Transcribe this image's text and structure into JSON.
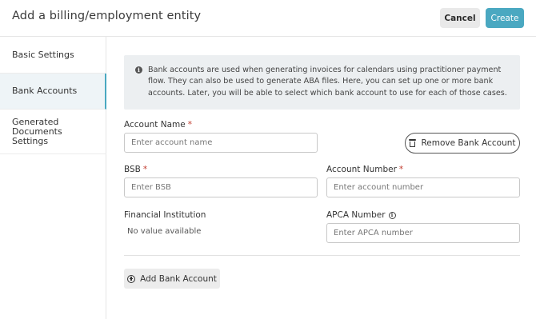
{
  "header": {
    "title": "Add a billing/employment entity",
    "cancel_label": "Cancel",
    "create_label": "Create"
  },
  "sidebar": {
    "items": [
      {
        "label": "Basic Settings"
      },
      {
        "label": "Bank Accounts",
        "active": true
      },
      {
        "label": "Generated Documents Settings"
      }
    ]
  },
  "info": {
    "icon": "info-icon",
    "text": "Bank accounts are used when generating invoices for calendars using practitioner payment flow. They can also be used to generate ABA files. Here, you can set up one or more bank accounts. Later, you will be able to select which bank account to use for each of those cases."
  },
  "form": {
    "account_name": {
      "label": "Account Name",
      "required_mark": "*",
      "placeholder": "Enter account name",
      "value": ""
    },
    "remove_button_label": "Remove Bank Account",
    "bsb": {
      "label": "BSB",
      "required_mark": "*",
      "placeholder": "Enter BSB",
      "value": ""
    },
    "account_number": {
      "label": "Account Number",
      "required_mark": "*",
      "placeholder": "Enter account number",
      "value": ""
    },
    "financial_institution": {
      "label": "Financial Institution",
      "value": "No value available"
    },
    "apca_number": {
      "label": "APCA Number",
      "placeholder": "Enter APCA number",
      "value": ""
    },
    "add_button_label": "Add Bank Account"
  },
  "colors": {
    "accent": "#4aa8c1",
    "required": "#c0392b",
    "info_bg": "#eceff1"
  }
}
